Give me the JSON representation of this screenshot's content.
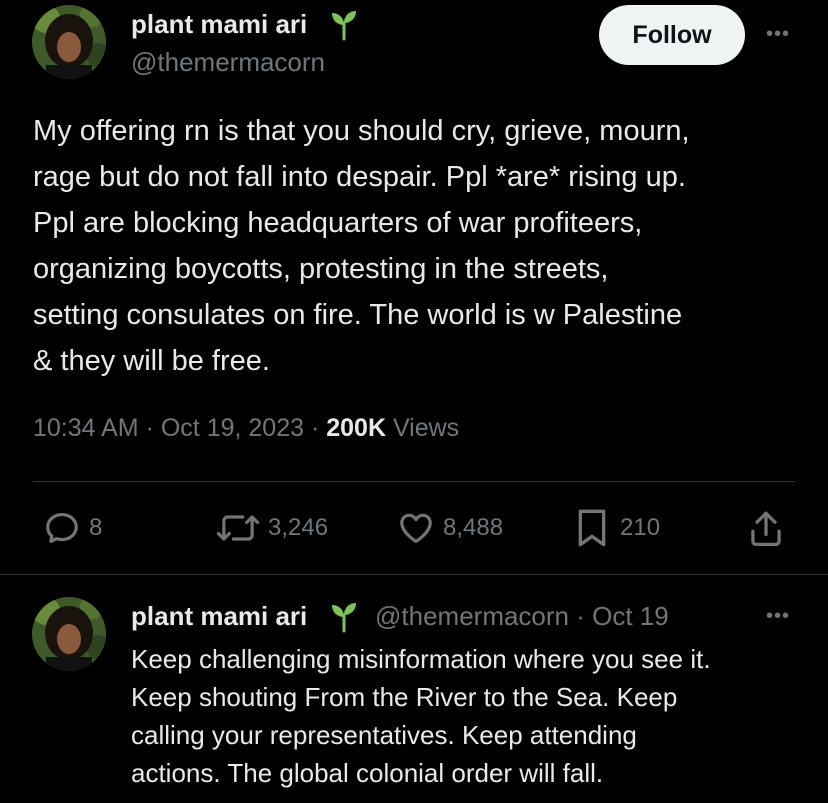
{
  "main_tweet": {
    "author": {
      "display_name": "plant mami ari",
      "handle": "@themermacorn",
      "emoji_icon": "seedling"
    },
    "follow_label": "Follow",
    "more_label": "•••",
    "text_lines": [
      "My offering rn is that you should cry, grieve, mourn,",
      "rage but do not fall into despair. Ppl *are* rising up.",
      "Ppl are blocking headquarters of war profiteers,",
      "organizing boycotts, protesting in the streets,",
      "setting consulates on fire. The world is w Palestine",
      "& they will be free."
    ],
    "time": "10:34 AM",
    "separator": " · ",
    "date": "Oct 19, 2023",
    "views_count": "200K",
    "views_label": " Views",
    "actions": {
      "replies": "8",
      "reposts": "3,246",
      "likes": "8,488",
      "bookmarks": "210"
    }
  },
  "reply_tweet": {
    "author": {
      "display_name": "plant mami ari",
      "emoji_icon": "seedling"
    },
    "handle_date": "@themermacorn · Oct 19",
    "more_label": "•••",
    "text_lines": [
      "Keep challenging misinformation where you see it.",
      "Keep shouting From the River to the Sea. Keep",
      "calling your representatives. Keep attending",
      "actions. The global colonial order will fall."
    ]
  },
  "colors": {
    "background": "#000000",
    "text_primary": "#e7e9ea",
    "text_secondary": "#71767b",
    "divider": "#2f3336",
    "follow_bg": "#eff3f4",
    "sprout_green": "#7dc45a"
  }
}
